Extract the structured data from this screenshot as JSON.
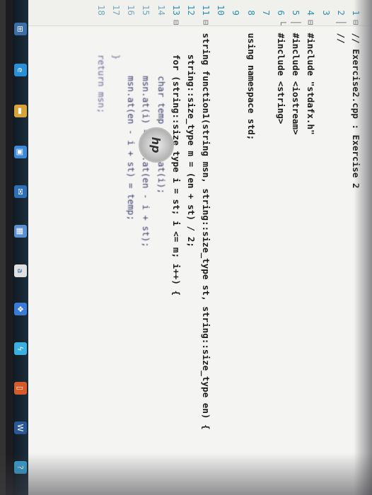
{
  "editor": {
    "lines": [
      {
        "n": "1",
        "fold": "⊟",
        "text": "// Exercise2.cpp : Exercise 2"
      },
      {
        "n": "2",
        "fold": "│",
        "text": "//"
      },
      {
        "n": "3",
        "fold": "",
        "text": ""
      },
      {
        "n": "4",
        "fold": "⊟",
        "text": "#include \"stdafx.h\""
      },
      {
        "n": "5",
        "fold": "│",
        "text": "#include <iostream>"
      },
      {
        "n": "6",
        "fold": "└",
        "text": "#include <string>"
      },
      {
        "n": "7",
        "fold": "",
        "text": ""
      },
      {
        "n": "8",
        "fold": "",
        "text": "using namespace std;"
      },
      {
        "n": "9",
        "fold": "",
        "text": ""
      },
      {
        "n": "10",
        "fold": "",
        "text": ""
      },
      {
        "n": "11",
        "fold": "⊟",
        "text": "string function1(string msn, string::size_type st, string::size_type en) {"
      },
      {
        "n": "12",
        "fold": "",
        "text": "    string::size_type m = (en + st) / 2;"
      },
      {
        "n": "13",
        "fold": "⊟",
        "text": "    for (string::size_type i = st; i <= m; i++) {"
      },
      {
        "n": "14",
        "fold": "",
        "text": "        char temp = msn.at(i);"
      },
      {
        "n": "15",
        "fold": "",
        "text": "        msn.at(i) = msn.at(en - i + st);"
      },
      {
        "n": "16",
        "fold": "",
        "text": "        msn.at(en - i + st) = temp;"
      },
      {
        "n": "17",
        "fold": "",
        "text": "    }"
      },
      {
        "n": "18",
        "fold": "",
        "text": "    return msn;"
      }
    ]
  },
  "taskbar": {
    "icons": [
      {
        "name": "start-icon",
        "glyph": "⊞",
        "color": "#3a6ea5"
      },
      {
        "name": "edge-icon",
        "glyph": "e",
        "color": "#2a8fd6"
      },
      {
        "name": "folder-icon",
        "glyph": "▬",
        "color": "#d8a43a"
      },
      {
        "name": "store-icon",
        "glyph": "▣",
        "color": "#3c8ad6"
      },
      {
        "name": "mail-icon",
        "glyph": "✉",
        "color": "#2f6fb6"
      },
      {
        "name": "photo-icon",
        "glyph": "▦",
        "color": "#5a8fd0"
      },
      {
        "name": "amazon-icon",
        "glyph": "a",
        "color": "#e0e0e0"
      },
      {
        "name": "dropbox-icon",
        "glyph": "❖",
        "color": "#3a7bd5"
      },
      {
        "name": "flash-icon",
        "glyph": "ϟ",
        "color": "#3ab0e0"
      },
      {
        "name": "office-icon",
        "glyph": "▯",
        "color": "#d65a2a"
      },
      {
        "name": "word-icon",
        "glyph": "W",
        "color": "#2b5797"
      },
      {
        "name": "help-icon",
        "glyph": "?",
        "color": "#3aa0d0"
      }
    ]
  },
  "logo": {
    "text": "hp"
  }
}
